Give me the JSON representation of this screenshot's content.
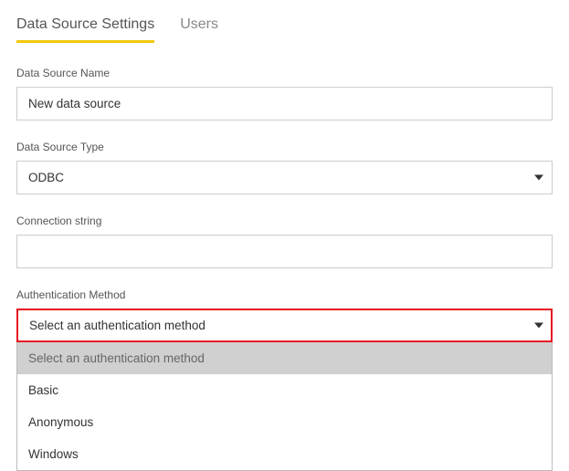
{
  "tabs": {
    "settings": "Data Source Settings",
    "users": "Users"
  },
  "fields": {
    "name_label": "Data Source Name",
    "name_value": "New data source",
    "type_label": "Data Source Type",
    "type_value": "ODBC",
    "conn_label": "Connection string",
    "conn_value": "",
    "auth_label": "Authentication Method",
    "auth_value": "Select an authentication method"
  },
  "auth_options": {
    "o0": "Select an authentication method",
    "o1": "Basic",
    "o2": "Anonymous",
    "o3": "Windows"
  }
}
